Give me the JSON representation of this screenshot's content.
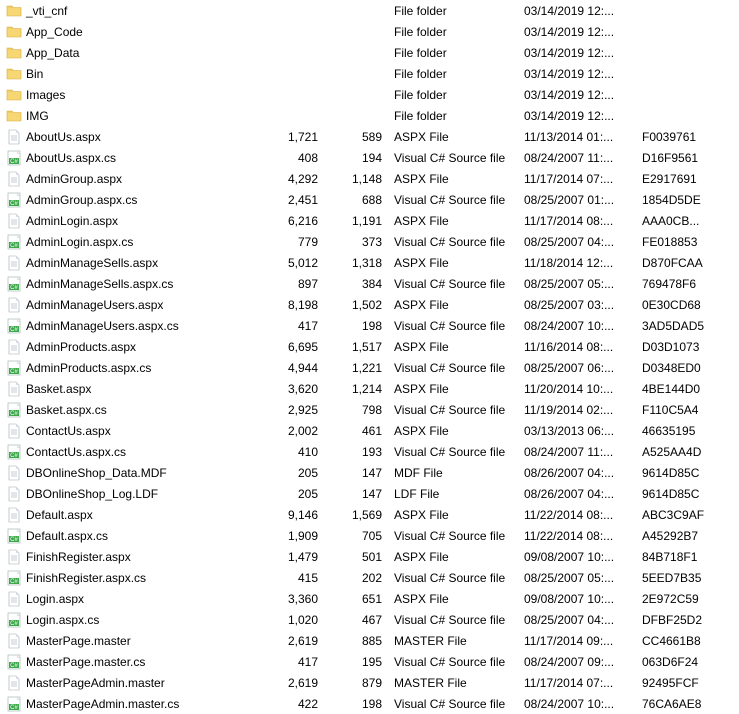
{
  "files": [
    {
      "icon": "folder",
      "name": "_vti_cnf",
      "size": "",
      "packed": "",
      "type": "File folder",
      "date": "03/14/2019 12:...",
      "crc": ""
    },
    {
      "icon": "folder",
      "name": "App_Code",
      "size": "",
      "packed": "",
      "type": "File folder",
      "date": "03/14/2019 12:...",
      "crc": ""
    },
    {
      "icon": "folder",
      "name": "App_Data",
      "size": "",
      "packed": "",
      "type": "File folder",
      "date": "03/14/2019 12:...",
      "crc": ""
    },
    {
      "icon": "folder",
      "name": "Bin",
      "size": "",
      "packed": "",
      "type": "File folder",
      "date": "03/14/2019 12:...",
      "crc": ""
    },
    {
      "icon": "folder",
      "name": "Images",
      "size": "",
      "packed": "",
      "type": "File folder",
      "date": "03/14/2019 12:...",
      "crc": ""
    },
    {
      "icon": "folder",
      "name": "IMG",
      "size": "",
      "packed": "",
      "type": "File folder",
      "date": "03/14/2019 12:...",
      "crc": ""
    },
    {
      "icon": "file",
      "name": "AboutUs.aspx",
      "size": "1,721",
      "packed": "589",
      "type": "ASPX File",
      "date": "11/13/2014 01:...",
      "crc": "F0039761"
    },
    {
      "icon": "cs",
      "name": "AboutUs.aspx.cs",
      "size": "408",
      "packed": "194",
      "type": "Visual C# Source file",
      "date": "08/24/2007 11:...",
      "crc": "D16F9561"
    },
    {
      "icon": "file",
      "name": "AdminGroup.aspx",
      "size": "4,292",
      "packed": "1,148",
      "type": "ASPX File",
      "date": "11/17/2014 07:...",
      "crc": "E2917691"
    },
    {
      "icon": "cs",
      "name": "AdminGroup.aspx.cs",
      "size": "2,451",
      "packed": "688",
      "type": "Visual C# Source file",
      "date": "08/25/2007 01:...",
      "crc": "1854D5DE"
    },
    {
      "icon": "file",
      "name": "AdminLogin.aspx",
      "size": "6,216",
      "packed": "1,191",
      "type": "ASPX File",
      "date": "11/17/2014 08:...",
      "crc": "AAA0CB..."
    },
    {
      "icon": "cs",
      "name": "AdminLogin.aspx.cs",
      "size": "779",
      "packed": "373",
      "type": "Visual C# Source file",
      "date": "08/25/2007 04:...",
      "crc": "FE018853"
    },
    {
      "icon": "file",
      "name": "AdminManageSells.aspx",
      "size": "5,012",
      "packed": "1,318",
      "type": "ASPX File",
      "date": "11/18/2014 12:...",
      "crc": "D870FCAA"
    },
    {
      "icon": "cs",
      "name": "AdminManageSells.aspx.cs",
      "size": "897",
      "packed": "384",
      "type": "Visual C# Source file",
      "date": "08/25/2007 05:...",
      "crc": "769478F6"
    },
    {
      "icon": "file",
      "name": "AdminManageUsers.aspx",
      "size": "8,198",
      "packed": "1,502",
      "type": "ASPX File",
      "date": "08/25/2007 03:...",
      "crc": "0E30CD68"
    },
    {
      "icon": "cs",
      "name": "AdminManageUsers.aspx.cs",
      "size": "417",
      "packed": "198",
      "type": "Visual C# Source file",
      "date": "08/24/2007 10:...",
      "crc": "3AD5DAD5"
    },
    {
      "icon": "file",
      "name": "AdminProducts.aspx",
      "size": "6,695",
      "packed": "1,517",
      "type": "ASPX File",
      "date": "11/16/2014 08:...",
      "crc": "D03D1073"
    },
    {
      "icon": "cs",
      "name": "AdminProducts.aspx.cs",
      "size": "4,944",
      "packed": "1,221",
      "type": "Visual C# Source file",
      "date": "08/25/2007 06:...",
      "crc": "D0348ED0"
    },
    {
      "icon": "file",
      "name": "Basket.aspx",
      "size": "3,620",
      "packed": "1,214",
      "type": "ASPX File",
      "date": "11/20/2014 10:...",
      "crc": "4BE144D0"
    },
    {
      "icon": "cs",
      "name": "Basket.aspx.cs",
      "size": "2,925",
      "packed": "798",
      "type": "Visual C# Source file",
      "date": "11/19/2014 02:...",
      "crc": "F110C5A4"
    },
    {
      "icon": "file",
      "name": "ContactUs.aspx",
      "size": "2,002",
      "packed": "461",
      "type": "ASPX File",
      "date": "03/13/2013 06:...",
      "crc": "46635195"
    },
    {
      "icon": "cs",
      "name": "ContactUs.aspx.cs",
      "size": "410",
      "packed": "193",
      "type": "Visual C# Source file",
      "date": "08/24/2007 11:...",
      "crc": "A525AA4D"
    },
    {
      "icon": "file",
      "name": "DBOnlineShop_Data.MDF",
      "size": "205",
      "packed": "147",
      "type": "MDF File",
      "date": "08/26/2007 04:...",
      "crc": "9614D85C"
    },
    {
      "icon": "file",
      "name": "DBOnlineShop_Log.LDF",
      "size": "205",
      "packed": "147",
      "type": "LDF File",
      "date": "08/26/2007 04:...",
      "crc": "9614D85C"
    },
    {
      "icon": "file",
      "name": "Default.aspx",
      "size": "9,146",
      "packed": "1,569",
      "type": "ASPX File",
      "date": "11/22/2014 08:...",
      "crc": "ABC3C9AF"
    },
    {
      "icon": "cs",
      "name": "Default.aspx.cs",
      "size": "1,909",
      "packed": "705",
      "type": "Visual C# Source file",
      "date": "11/22/2014 08:...",
      "crc": "A45292B7"
    },
    {
      "icon": "file",
      "name": "FinishRegister.aspx",
      "size": "1,479",
      "packed": "501",
      "type": "ASPX File",
      "date": "09/08/2007 10:...",
      "crc": "84B718F1"
    },
    {
      "icon": "cs",
      "name": "FinishRegister.aspx.cs",
      "size": "415",
      "packed": "202",
      "type": "Visual C# Source file",
      "date": "08/25/2007 05:...",
      "crc": "5EED7B35"
    },
    {
      "icon": "file",
      "name": "Login.aspx",
      "size": "3,360",
      "packed": "651",
      "type": "ASPX File",
      "date": "09/08/2007 10:...",
      "crc": "2E972C59"
    },
    {
      "icon": "cs",
      "name": "Login.aspx.cs",
      "size": "1,020",
      "packed": "467",
      "type": "Visual C# Source file",
      "date": "08/25/2007 04:...",
      "crc": "DFBF25D2"
    },
    {
      "icon": "file",
      "name": "MasterPage.master",
      "size": "2,619",
      "packed": "885",
      "type": "MASTER File",
      "date": "11/17/2014 09:...",
      "crc": "CC4661B8"
    },
    {
      "icon": "cs",
      "name": "MasterPage.master.cs",
      "size": "417",
      "packed": "195",
      "type": "Visual C# Source file",
      "date": "08/24/2007 09:...",
      "crc": "063D6F24"
    },
    {
      "icon": "file",
      "name": "MasterPageAdmin.master",
      "size": "2,619",
      "packed": "879",
      "type": "MASTER File",
      "date": "11/17/2014 07:...",
      "crc": "92495FCF"
    },
    {
      "icon": "cs",
      "name": "MasterPageAdmin.master.cs",
      "size": "422",
      "packed": "198",
      "type": "Visual C# Source file",
      "date": "08/24/2007 10:...",
      "crc": "76CA6AE8"
    }
  ]
}
